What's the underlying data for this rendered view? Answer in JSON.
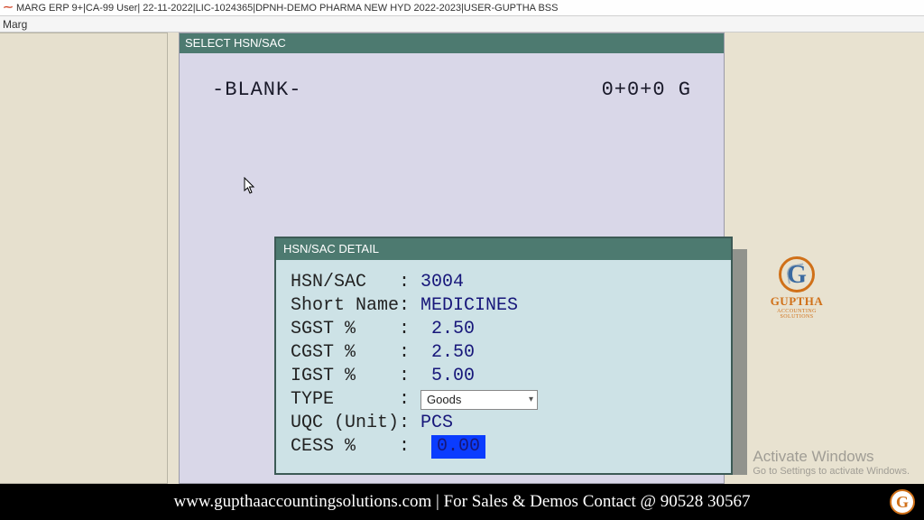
{
  "titlebar": {
    "text": "MARG ERP 9+|CA-99 User| 22-11-2022|LIC-1024365|DPNH-DEMO PHARMA NEW HYD 2022-2023|USER-GUPTHA BSS"
  },
  "menubar": {
    "item": "Marg"
  },
  "select_panel": {
    "header": "SELECT HSN/SAC",
    "blank": "-BLANK-",
    "summary": "0+0+0 G"
  },
  "dialog": {
    "header": "HSN/SAC DETAIL",
    "fields": {
      "hsn_label": "HSN/SAC   : ",
      "hsn_value": "3004",
      "short_label": "Short Name: ",
      "short_value": "MEDICINES",
      "sgst_label": "SGST %    :  ",
      "sgst_value": "2.50",
      "cgst_label": "CGST %    :  ",
      "cgst_value": "2.50",
      "igst_label": "IGST %    :  ",
      "igst_value": "5.00",
      "type_label": "TYPE      : ",
      "type_value": "Goods",
      "uqc_label": "UQC (Unit): ",
      "uqc_value": "PCS",
      "cess_label": "CESS %    :  ",
      "cess_value": "0.00"
    }
  },
  "logo": {
    "brand": "GUPTHA",
    "sub": "ACCOUNTING SOLUTIONS"
  },
  "activate": {
    "line1": "Activate Windows",
    "line2": "Go to Settings to activate Windows."
  },
  "footer": {
    "text": "www.gupthaaccountingsolutions.com | For Sales & Demos Contact @ 90528 30567"
  }
}
